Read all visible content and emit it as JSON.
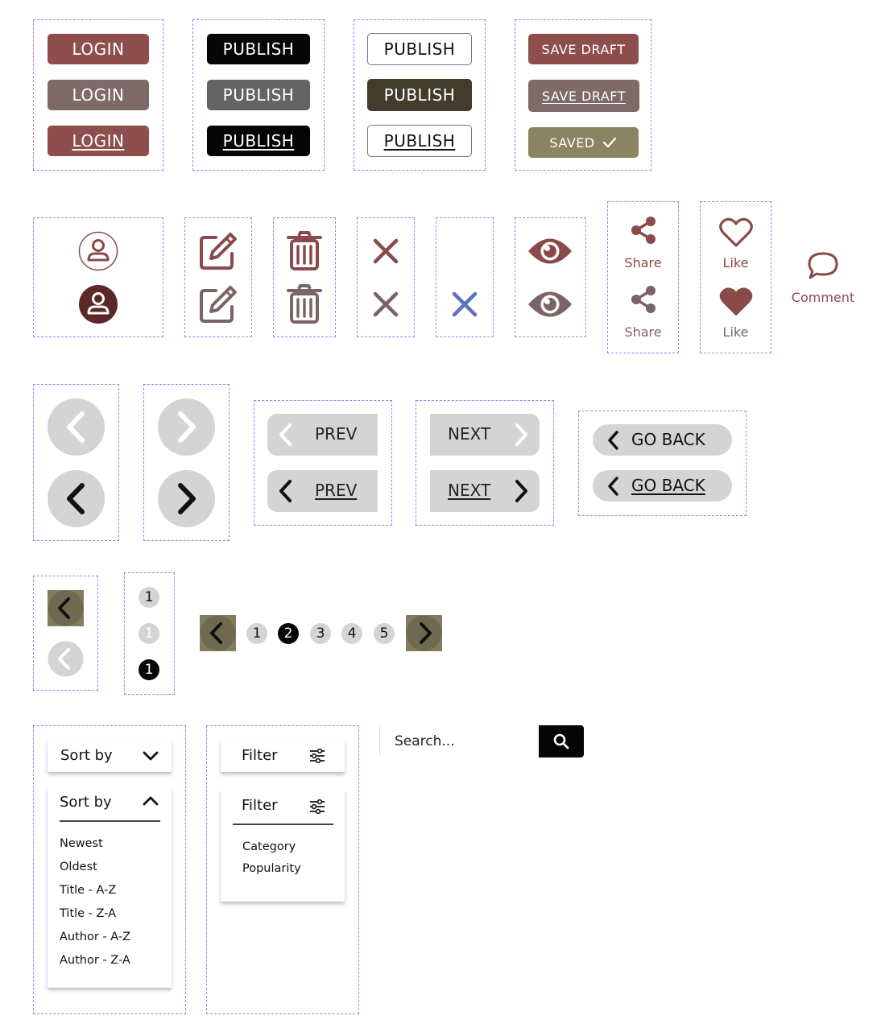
{
  "colors": {
    "maroon": "#8f4e4e",
    "maroon_muted": "#7f6a6a",
    "black": "#050505",
    "slate": "#646464",
    "olive_dark": "#423c2d",
    "olive_saved": "#8a8463",
    "icon_brown": "#8a4a4a",
    "icon_muted": "#7b6464",
    "close_blue": "#5b73be",
    "nav_gray": "#d4d4d4",
    "pager_olive": "#837c5d",
    "dashed_border": "#a77cf0"
  },
  "login": {
    "default": "LOGIN",
    "hover": "LOGIN",
    "focus": "LOGIN"
  },
  "publish_dark": {
    "default": "PUBLISH",
    "hover": "PUBLISH",
    "focus": "PUBLISH"
  },
  "publish_outline": {
    "default": "PUBLISH",
    "hover": "PUBLISH",
    "focus": "PUBLISH"
  },
  "save_draft": {
    "default": "SAVE DRAFT",
    "hover": "SAVE DRAFT",
    "saved": "SAVED"
  },
  "icons": {
    "user": "user-icon",
    "edit": "edit-icon",
    "trash": "trash-icon",
    "close": "close-icon",
    "eye": "eye-icon",
    "share": "share-icon",
    "heart": "heart-icon",
    "comment": "comment-icon",
    "chevron_left": "chevron-left-icon",
    "chevron_right": "chevron-right-icon",
    "check": "check-icon",
    "search": "search-icon",
    "sliders": "sliders-icon",
    "chevron_down": "chevron-down-icon",
    "chevron_up": "chevron-up-icon"
  },
  "social": {
    "share_label": "Share",
    "share_label_2": "Share",
    "like_label": "Like",
    "like_label_2": "Like",
    "comment_label": "Comment"
  },
  "nav": {
    "prev": "PREV",
    "prev_2": "PREV",
    "next": "NEXT",
    "next_2": "NEXT",
    "go_back": "GO BACK",
    "go_back_2": "GO BACK"
  },
  "page_dots": [
    "1",
    "1",
    "1"
  ],
  "pagination": {
    "pages": [
      "1",
      "2",
      "3",
      "4",
      "5"
    ],
    "current": "2"
  },
  "sort": {
    "label": "Sort by",
    "label_open": "Sort by",
    "options": [
      "Newest",
      "Oldest",
      "Title - A-Z",
      "Title - Z-A",
      "Author - A-Z",
      "Author - Z-A"
    ]
  },
  "filter": {
    "label": "Filter",
    "label_open": "Filter",
    "options": [
      "Category",
      "Popularity"
    ]
  },
  "search": {
    "placeholder": "Search..."
  }
}
